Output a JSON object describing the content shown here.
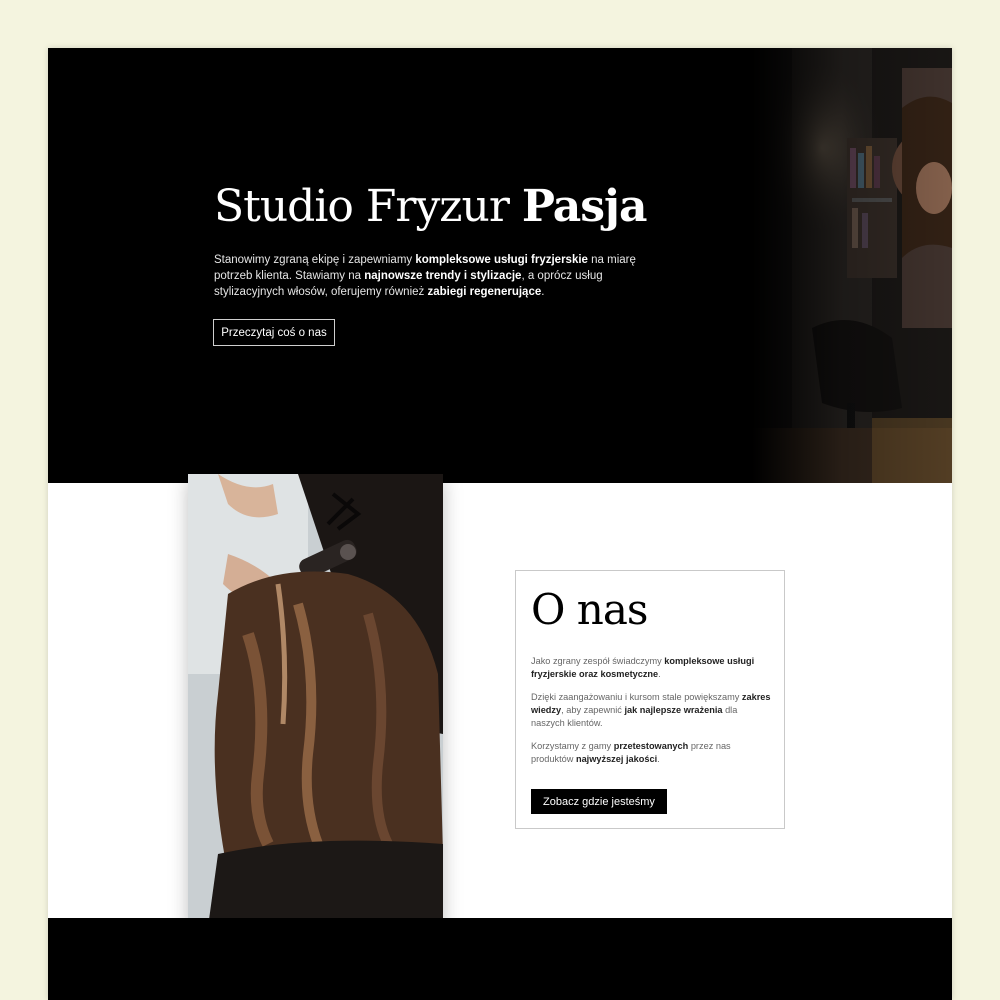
{
  "hero": {
    "title_regular": "Studio Fryzur",
    "title_bold": "Pasja",
    "paragraph": [
      {
        "text": "Stanowimy zgraną ekipę i zapewniamy ",
        "bold": false
      },
      {
        "text": "kompleksowe usługi fryzjerskie",
        "bold": true
      },
      {
        "text": " na miarę potrzeb klienta. Stawiamy na ",
        "bold": false
      },
      {
        "text": "najnowsze trendy i stylizacje",
        "bold": true
      },
      {
        "text": ", a oprócz usług stylizacyjnych włosów, oferujemy również ",
        "bold": false
      },
      {
        "text": "zabiegi regenerujące",
        "bold": true
      },
      {
        "text": ".",
        "bold": false
      }
    ],
    "button_label": "Przeczytaj coś o nas"
  },
  "about": {
    "title": "O nas",
    "paragraphs": [
      [
        {
          "text": "Jako zgrany zespół świadczymy ",
          "bold": false
        },
        {
          "text": "kompleksowe usługi fryzjerskie oraz kosmetyczne",
          "bold": true
        },
        {
          "text": ".",
          "bold": false
        }
      ],
      [
        {
          "text": "Dzięki zaangażowaniu i kursom stale powiększamy ",
          "bold": false
        },
        {
          "text": "zakres wiedzy",
          "bold": true
        },
        {
          "text": ", aby zapewnić ",
          "bold": false
        },
        {
          "text": "jak najlepsze wrażenia",
          "bold": true
        },
        {
          "text": " dla naszych klientów.",
          "bold": false
        }
      ],
      [
        {
          "text": "Korzystamy z gamy ",
          "bold": false
        },
        {
          "text": "przetestowanych",
          "bold": true
        },
        {
          "text": " przez nas produktów ",
          "bold": false
        },
        {
          "text": "najwyższej jakości",
          "bold": true
        },
        {
          "text": ".",
          "bold": false
        }
      ]
    ],
    "button_label": "Zobacz gdzie jesteśmy"
  },
  "colors": {
    "page_background": "#f4f4df",
    "hero_background": "#000000",
    "accent_button": "#000000"
  }
}
